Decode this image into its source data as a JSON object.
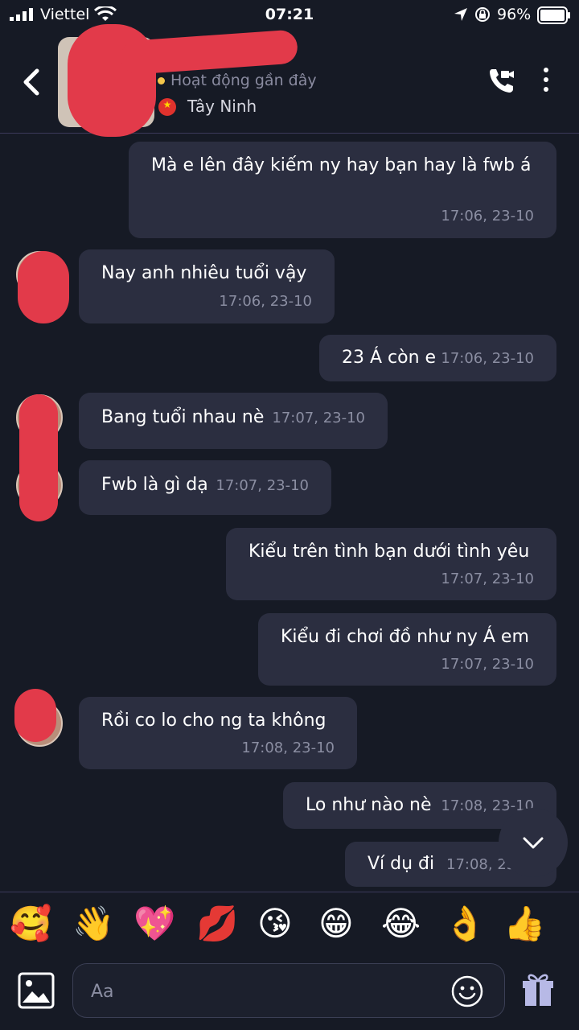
{
  "status_bar": {
    "carrier": "Viettel",
    "time": "07:21",
    "battery": "96%"
  },
  "header": {
    "status": "Hoạt động gần đây",
    "location": "Tây Ninh"
  },
  "messages": [
    {
      "side": "sent",
      "text": "Mà e lên đây kiếm ny hay bạn hay là fwb á",
      "time": "17:06, 23-10"
    },
    {
      "side": "received",
      "text": "Nay anh nhiêu tuổi vậy",
      "time": "17:06, 23-10"
    },
    {
      "side": "sent",
      "text": "23 Á còn e",
      "time": "17:06, 23-10"
    },
    {
      "side": "received",
      "text": "Bang tuổi nhau nè",
      "time": "17:07, 23-10"
    },
    {
      "side": "received",
      "text": "Fwb là gì dạ",
      "time": "17:07, 23-10"
    },
    {
      "side": "sent",
      "text": "Kiểu trên tình bạn dưới tình yêu",
      "time": "17:07, 23-10"
    },
    {
      "side": "sent",
      "text": "Kiểu đi chơi đồ như ny Á em",
      "time": "17:07, 23-10"
    },
    {
      "side": "received",
      "text": "Rồi co lo cho ng ta không",
      "time": "17:08, 23-10"
    },
    {
      "side": "sent",
      "text": "Lo như nào nè",
      "time": "17:08, 23-10"
    },
    {
      "side": "sent",
      "text": "Ví dụ đi",
      "time": "17:08, 23-10"
    }
  ],
  "emojis": [
    "🥰",
    "👋",
    "💖",
    "💋",
    "😘",
    "😁",
    "😂",
    "👌",
    "👍"
  ],
  "composer": {
    "placeholder": "Aa"
  },
  "colors": {
    "background": "#161a25",
    "bubble": "#2b2e40",
    "status_dot": "#f4c64b",
    "redaction": "#e23a4a"
  }
}
